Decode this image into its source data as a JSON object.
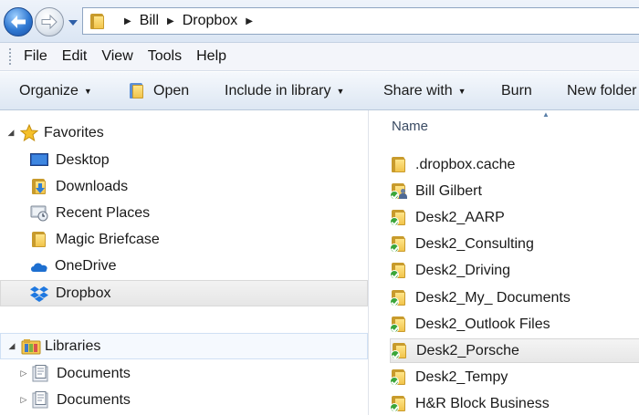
{
  "address_bar": {
    "breadcrumb": [
      "Bill",
      "Dropbox"
    ]
  },
  "menu": [
    "File",
    "Edit",
    "View",
    "Tools",
    "Help"
  ],
  "toolbar": {
    "organize": "Organize",
    "open": "Open",
    "include_in_library": "Include in library",
    "share_with": "Share with",
    "burn": "Burn",
    "new_folder": "New folder"
  },
  "nav_pane": {
    "favorites_label": "Favorites",
    "favorites": [
      {
        "label": "Desktop",
        "icon": "desktop-icon"
      },
      {
        "label": "Downloads",
        "icon": "downloads-folder-icon"
      },
      {
        "label": "Recent Places",
        "icon": "recent-places-icon"
      },
      {
        "label": "Magic Briefcase",
        "icon": "folder-icon"
      },
      {
        "label": "OneDrive",
        "icon": "onedrive-icon"
      },
      {
        "label": "Dropbox",
        "icon": "dropbox-icon",
        "selected": true
      }
    ],
    "libraries_label": "Libraries",
    "libraries": [
      {
        "label": "Documents",
        "icon": "documents-library-icon"
      },
      {
        "label": "Documents",
        "icon": "documents-library-icon"
      }
    ]
  },
  "file_list": {
    "column_name": "Name",
    "items": [
      {
        "name": ".dropbox.cache",
        "icon": "folder-icon"
      },
      {
        "name": "Bill Gilbert",
        "icon": "shared-synced-folder-icon"
      },
      {
        "name": "Desk2_AARP",
        "icon": "synced-folder-icon"
      },
      {
        "name": "Desk2_Consulting",
        "icon": "synced-folder-icon"
      },
      {
        "name": "Desk2_Driving",
        "icon": "synced-folder-icon"
      },
      {
        "name": "Desk2_My_ Documents",
        "icon": "synced-folder-icon"
      },
      {
        "name": "Desk2_Outlook Files",
        "icon": "synced-folder-icon"
      },
      {
        "name": "Desk2_Porsche",
        "icon": "synced-folder-icon",
        "selected": true
      },
      {
        "name": "Desk2_Tempy",
        "icon": "synced-folder-icon"
      },
      {
        "name": "H&R Block Business",
        "icon": "synced-folder-icon"
      }
    ]
  }
}
